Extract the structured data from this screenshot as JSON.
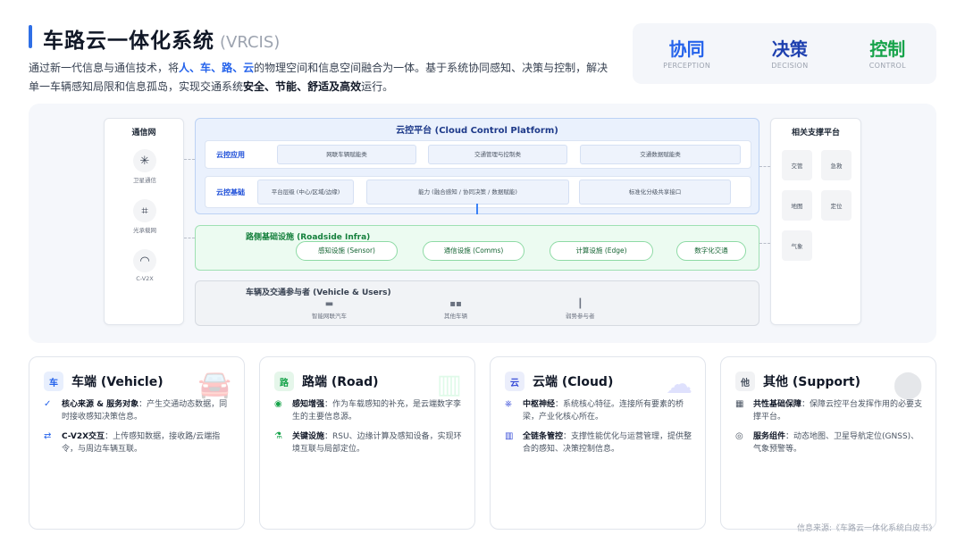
{
  "header": {
    "title": "车路云一体化系统",
    "title_en": "(VRCIS)",
    "intro": {
      "p1": "通过新一代信息与通信技术，将",
      "k1": "人",
      "s1": "、",
      "k2": "车",
      "s2": "、",
      "k3": "路",
      "s3": "、",
      "k4": "云",
      "p2": "的物理空间和信息空间融合为一体。基于系统协同感知、决策与控制，解决单一车辆感知局限和信息孤岛，实现交通系统",
      "b1": "安全",
      "s4": "、",
      "b2": "节能",
      "s5": "、",
      "b3": "舒适及高效",
      "p3": "运行。"
    }
  },
  "pillars": [
    {
      "cn": "协同",
      "en": "PERCEPTION",
      "color": "#2563eb"
    },
    {
      "cn": "决策",
      "en": "DECISION",
      "color": "#1e40af"
    },
    {
      "cn": "控制",
      "en": "CONTROL",
      "color": "#16a34a"
    }
  ],
  "diagram": {
    "network": {
      "title": "通信网",
      "items": [
        {
          "icon": "satellite-icon",
          "glyph": "✳",
          "label": "卫星通信"
        },
        {
          "icon": "fiber-network-icon",
          "glyph": "⌗",
          "label": "光承载网"
        },
        {
          "icon": "wireless-icon",
          "glyph": "◠",
          "label": "C-V2X"
        }
      ]
    },
    "cloud": {
      "title": "云控平台 (Cloud Control Platform)",
      "app_label": "云控应用",
      "apps": [
        "网联车辆赋能类",
        "交通管理与控制类",
        "交通数据赋能类"
      ],
      "base_label": "云控基础",
      "bases": [
        "平台层级 (中心/区域/边缘)",
        "能力 (融合感知 / 协同决策 / 数据赋能)",
        "标准化分级共享接口"
      ]
    },
    "road": {
      "title": "路侧基础设施 (Roadside Infra)",
      "items": [
        "感知设施 (Sensor)",
        "通信设施 (Comms)",
        "计算设施 (Edge)",
        "数字化交通"
      ]
    },
    "vehicle": {
      "title": "车辆及交通参与者 (Vehicle & Users)",
      "items": [
        {
          "icon": "connected-car-icon",
          "label": "智能网联汽车"
        },
        {
          "icon": "other-vehicle-icon",
          "label": "其他车辆"
        },
        {
          "icon": "pedestrian-icon",
          "label": "弱势参与者"
        }
      ]
    },
    "support": {
      "title": "相关支撑平台",
      "items": [
        "交管",
        "急救",
        "地图",
        "定位",
        "气象"
      ]
    }
  },
  "cards": [
    {
      "badge": "车",
      "title": "车端 (Vehicle)",
      "ghost_icon": "car-icon",
      "ghost_glyph": "🚘",
      "badge_bg": "#e8effd",
      "badge_fg": "#2563eb",
      "ghost_fg": "#9ca3af",
      "items": [
        {
          "icon": "check-circle-icon",
          "glyph": "✓",
          "icon_color": "#2563eb",
          "bold": "核心来源 & 服务对象",
          "text": "：产生交通动态数据，同时接收感知决策信息。"
        },
        {
          "icon": "exchange-icon",
          "glyph": "⇄",
          "icon_color": "#2563eb",
          "bold": "C-V2X交互",
          "text": "：上传感知数据，接收路/云端指令，与周边车辆互联。"
        }
      ]
    },
    {
      "badge": "路",
      "title": "路端 (Road)",
      "ghost_icon": "roadside-icon",
      "ghost_glyph": "▥",
      "badge_bg": "#e5f6ea",
      "badge_fg": "#16a34a",
      "ghost_fg": "#86efac",
      "items": [
        {
          "icon": "eye-icon",
          "glyph": "◉",
          "icon_color": "#16a34a",
          "bold": "感知增强",
          "text": "：作为车载感知的补充，是云端数字孪生的主要信息源。"
        },
        {
          "icon": "flask-icon",
          "glyph": "⚗",
          "icon_color": "#16a34a",
          "bold": "关键设施",
          "text": "：RSU、边缘计算及感知设备，实现环境互联与局部定位。"
        }
      ]
    },
    {
      "badge": "云",
      "title": "云端 (Cloud)",
      "ghost_icon": "cloud-download-icon",
      "ghost_glyph": "☁",
      "badge_bg": "#ebeefb",
      "badge_fg": "#3b4fd8",
      "ghost_fg": "#818cf8",
      "items": [
        {
          "icon": "nerve-icon",
          "glyph": "⎈",
          "icon_color": "#3b4fd8",
          "bold": "中枢神经",
          "text": "：系统核心特征。连接所有要素的桥梁，产业化核心所在。"
        },
        {
          "icon": "bar-chart-icon",
          "glyph": "▥",
          "icon_color": "#3b4fd8",
          "bold": "全链条管控",
          "text": "：支撑性能优化与运营管理，提供整合的感知、决策控制信息。"
        }
      ]
    },
    {
      "badge": "他",
      "title": "其他 (Support)",
      "ghost_icon": "map-pin-icon",
      "ghost_glyph": "⬤",
      "badge_bg": "#f1f2f4",
      "badge_fg": "#4b5563",
      "ghost_fg": "#9ca3af",
      "items": [
        {
          "icon": "building-icon",
          "glyph": "▦",
          "icon_color": "#4b5563",
          "bold": "共性基础保障",
          "text": "：保障云控平台发挥作用的必要支撑平台。"
        },
        {
          "icon": "compass-icon",
          "glyph": "◎",
          "icon_color": "#4b5563",
          "bold": "服务组件",
          "text": "：动态地图、卫星导航定位(GNSS)、气象预警等。"
        }
      ]
    }
  ],
  "source": "信息来源:《车路云一体化系统白皮书》"
}
